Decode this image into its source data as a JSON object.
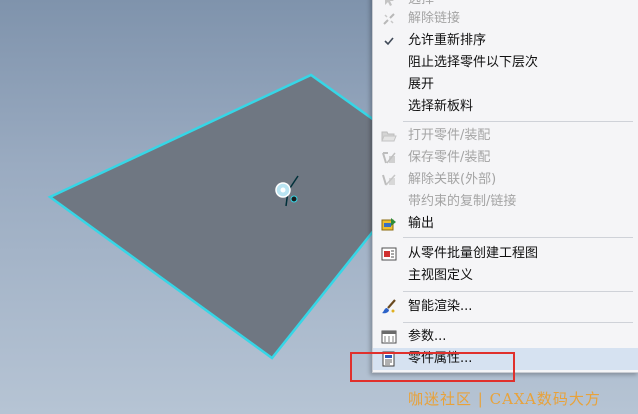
{
  "menu": {
    "items": [
      {
        "label": "选择",
        "icon": "cursor-icon",
        "disabled": true
      },
      {
        "label": "解除链接",
        "icon": "unlink-icon",
        "disabled": true
      },
      {
        "label": "允许重新排序",
        "icon": "checkmark-icon",
        "disabled": false
      },
      {
        "label": "阻止选择零件以下层次",
        "icon": "",
        "disabled": false
      },
      {
        "label": "展开",
        "icon": "",
        "disabled": false
      },
      {
        "label": "选择新板料",
        "icon": "",
        "disabled": false
      },
      {
        "label": "打开零件/装配",
        "icon": "folder-open-icon",
        "disabled": true
      },
      {
        "label": "保存零件/装配",
        "icon": "save-part-icon",
        "disabled": true
      },
      {
        "label": "解除关联(外部)",
        "icon": "break-link-icon",
        "disabled": true
      },
      {
        "label": "带约束的复制/链接",
        "icon": "",
        "disabled": true
      },
      {
        "label": "输出",
        "icon": "export-icon",
        "disabled": false
      },
      {
        "label": "从零件批量创建工程图",
        "icon": "batch-drawing-icon",
        "disabled": false
      },
      {
        "label": "主视图定义",
        "icon": "",
        "disabled": false
      },
      {
        "label": "智能渲染...",
        "icon": "paintbrush-icon",
        "disabled": false
      },
      {
        "label": "参数...",
        "icon": "parameters-icon",
        "disabled": false
      },
      {
        "label": "零件属性...",
        "icon": "part-properties-icon",
        "disabled": false
      }
    ]
  },
  "watermark": "咖迷社区 | CAXA数码大方",
  "colors": {
    "plate": "#6f7782",
    "plate_edge": "#36d6e6",
    "highlight_box": "#e0302c",
    "menu_bg": "#f5f5f7",
    "menu_highlight": "#d6e2f1",
    "watermark": "#e8a23a"
  }
}
